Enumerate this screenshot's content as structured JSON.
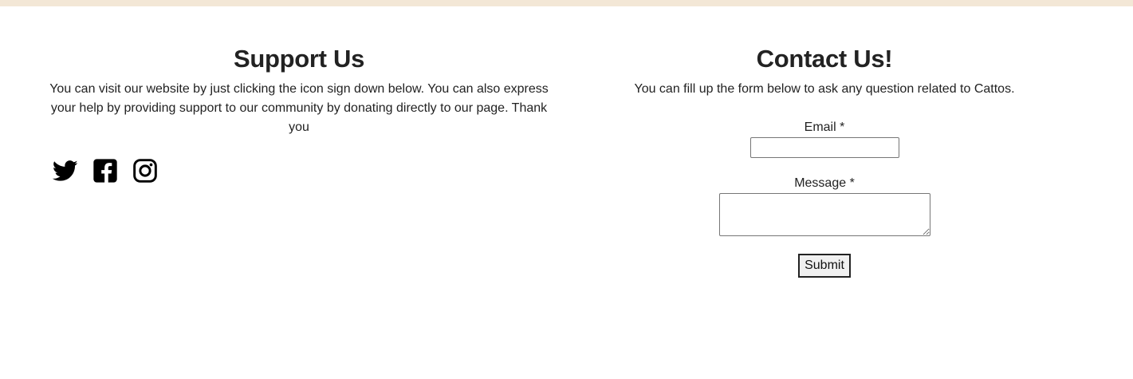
{
  "support": {
    "title": "Support Us",
    "description": "You can visit our website by just clicking the icon sign down below. You can also express your help by providing support to our community by donating directly to our page. Thank you",
    "social_icons": [
      "twitter-icon",
      "facebook-square-icon",
      "instagram-icon"
    ]
  },
  "contact": {
    "title": "Contact Us!",
    "description": "You can fill up the form below to ask any question related to Cattos.",
    "email_label": "Email *",
    "email_value": "",
    "message_label": "Message *",
    "message_value": "",
    "submit_label": "Submit"
  },
  "colors": {
    "top_strip": "#f3e7d6",
    "text": "#222222",
    "icon": "#000000"
  }
}
